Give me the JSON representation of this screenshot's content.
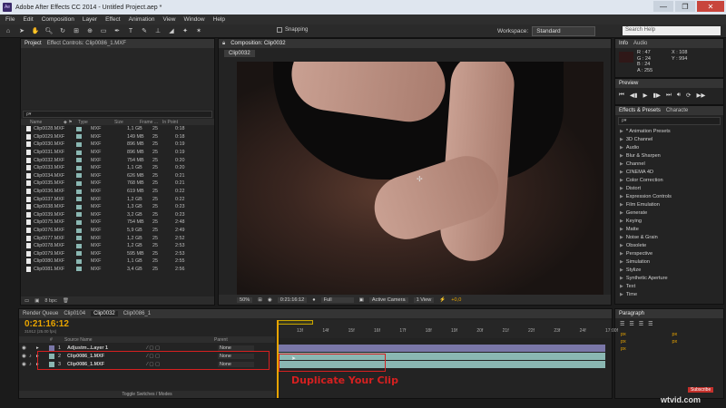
{
  "window": {
    "title": "Adobe After Effects CC 2014 - Untitled Project.aep *",
    "app_icon": "Ae",
    "controls": [
      "—",
      "❐",
      "✕"
    ]
  },
  "menu": [
    "File",
    "Edit",
    "Composition",
    "Layer",
    "Effect",
    "Animation",
    "View",
    "Window",
    "Help"
  ],
  "toolbar": {
    "snapping_label": "Snapping",
    "workspace_label": "Workspace:",
    "workspace_value": "Standard",
    "search_placeholder": "Search Help"
  },
  "project_panel": {
    "tabs": [
      "Project",
      "Effect Controls: Clip0086_1.MXF"
    ],
    "search_value": "ρ▾",
    "columns": [
      "Name",
      "",
      "Type",
      "Size",
      "Frame ...",
      "In Point"
    ],
    "files": [
      {
        "name": "Clip0028.MXF",
        "type": "MXF",
        "size": "1,1 GB",
        "fps": "25",
        "in": "0:18"
      },
      {
        "name": "Clip0029.MXF",
        "type": "MXF",
        "size": "149 MB",
        "fps": "25",
        "in": "0:18"
      },
      {
        "name": "Clip0030.MXF",
        "type": "MXF",
        "size": "896 MB",
        "fps": "25",
        "in": "0:19"
      },
      {
        "name": "Clip0031.MXF",
        "type": "MXF",
        "size": "896 MB",
        "fps": "25",
        "in": "0:19"
      },
      {
        "name": "Clip0032.MXF",
        "type": "MXF",
        "size": "754 MB",
        "fps": "25",
        "in": "0:20"
      },
      {
        "name": "Clip0033.MXF",
        "type": "MXF",
        "size": "1,1 GB",
        "fps": "25",
        "in": "0:20"
      },
      {
        "name": "Clip0034.MXF",
        "type": "MXF",
        "size": "626 MB",
        "fps": "25",
        "in": "0:21"
      },
      {
        "name": "Clip0035.MXF",
        "type": "MXF",
        "size": "768 MB",
        "fps": "25",
        "in": "0:21"
      },
      {
        "name": "Clip0036.MXF",
        "type": "MXF",
        "size": "619 MB",
        "fps": "25",
        "in": "0:22"
      },
      {
        "name": "Clip0037.MXF",
        "type": "MXF",
        "size": "1,2 GB",
        "fps": "25",
        "in": "0:22"
      },
      {
        "name": "Clip0038.MXF",
        "type": "MXF",
        "size": "1,3 GB",
        "fps": "25",
        "in": "0:23"
      },
      {
        "name": "Clip0039.MXF",
        "type": "MXF",
        "size": "3,2 GB",
        "fps": "25",
        "in": "0:23"
      },
      {
        "name": "Clip0075.MXF",
        "type": "MXF",
        "size": "754 MB",
        "fps": "25",
        "in": "2:48"
      },
      {
        "name": "Clip0076.MXF",
        "type": "MXF",
        "size": "5,9 GB",
        "fps": "25",
        "in": "2:49"
      },
      {
        "name": "Clip0077.MXF",
        "type": "MXF",
        "size": "1,2 GB",
        "fps": "25",
        "in": "2:52"
      },
      {
        "name": "Clip0078.MXF",
        "type": "MXF",
        "size": "1,2 GB",
        "fps": "25",
        "in": "2:53"
      },
      {
        "name": "Clip0079.MXF",
        "type": "MXF",
        "size": "595 MB",
        "fps": "25",
        "in": "2:53"
      },
      {
        "name": "Clip0080.MXF",
        "type": "MXF",
        "size": "1,1 GB",
        "fps": "25",
        "in": "2:55"
      },
      {
        "name": "Clip0081.MXF",
        "type": "MXF",
        "size": "3,4 GB",
        "fps": "25",
        "in": "2:56"
      }
    ],
    "bpc": "8 bpc"
  },
  "composition": {
    "tab": "Composition: Clip0032",
    "sub_tab": "Clip0032",
    "zoom": "50%",
    "timecode": "0:21:16:12",
    "resolution": "Full",
    "camera": "Active Camera",
    "view": "1 View",
    "exposure": "+0,0"
  },
  "info_panel": {
    "tabs": [
      "Info",
      "Audio"
    ],
    "r": "R : 47",
    "g": "G : 24",
    "b": "B : 24",
    "a": "A : 255",
    "x": "X : 108",
    "y": "Y : 994"
  },
  "preview_panel": {
    "title": "Preview"
  },
  "effects_panel": {
    "tabs": [
      "Effects & Presets",
      "Characte"
    ],
    "search_value": "ρ▾",
    "items": [
      "* Animation Presets",
      "3D Channel",
      "Audio",
      "Blur & Sharpen",
      "Channel",
      "CINEMA 4D",
      "Color Correction",
      "Distort",
      "Expression Controls",
      "Film Emulation",
      "Generate",
      "Keying",
      "Matte",
      "Noise & Grain",
      "Obsolete",
      "Perspective",
      "Simulation",
      "Stylize",
      "Synthetic Aperture",
      "Text",
      "Time"
    ]
  },
  "paragraph_panel": {
    "title": "Paragraph",
    "units": [
      "px",
      "px",
      "px",
      "px",
      "px"
    ]
  },
  "timeline": {
    "tabs": [
      "Render Queue",
      "Clip0104",
      "Clip0032",
      "Clip0086_1"
    ],
    "timecode": "0:21:16:12",
    "sub_timecode": "31912 (25.00 fps)",
    "columns": [
      "#",
      "Source Name",
      "",
      "Parent"
    ],
    "layers": [
      {
        "num": "1",
        "name": "Adjustm...Layer 1",
        "parent": "None"
      },
      {
        "num": "2",
        "name": "Clip0086_1.MXF",
        "parent": "None"
      },
      {
        "num": "3",
        "name": "Clip0086_1.MXF",
        "parent": "None"
      }
    ],
    "ruler": [
      "13f",
      "14f",
      "15f",
      "16f",
      "17f",
      "18f",
      "19f",
      "20f",
      "21f",
      "22f",
      "23f",
      "24f",
      "17:00f"
    ],
    "annotation": "Duplicate Your Clip",
    "toggle_label": "Toggle Switches / Modes"
  },
  "watermark": {
    "subscribe": "Subscribe",
    "site": "wtvid.com"
  },
  "colors": {
    "accent_orange": "#e8a400",
    "label_purple": "#7a77a8",
    "label_cyan": "#8ab7b2",
    "annotation_red": "#d62020"
  }
}
